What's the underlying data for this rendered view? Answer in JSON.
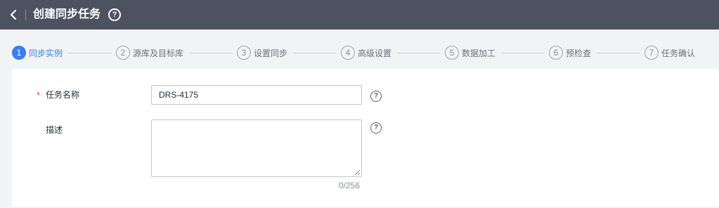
{
  "header": {
    "title": "创建同步任务",
    "help_glyph": "?"
  },
  "steps": [
    {
      "number": "1",
      "label": "同步实例",
      "active": true
    },
    {
      "number": "2",
      "label": "源库及目标库",
      "active": false
    },
    {
      "number": "3",
      "label": "设置同步",
      "active": false
    },
    {
      "number": "4",
      "label": "高级设置",
      "active": false
    },
    {
      "number": "5",
      "label": "数据加工",
      "active": false
    },
    {
      "number": "6",
      "label": "预检查",
      "active": false
    },
    {
      "number": "7",
      "label": "任务确认",
      "active": false
    }
  ],
  "form": {
    "task_name": {
      "required_mark": "*",
      "label": "任务名称",
      "value": "DRS-4175",
      "help_glyph": "?"
    },
    "description": {
      "label": "描述",
      "value": "",
      "help_glyph": "?",
      "char_count": "0/256"
    }
  },
  "colors": {
    "header_bg": "#4d5261",
    "accent": "#3b7ded",
    "required": "#e54545"
  }
}
